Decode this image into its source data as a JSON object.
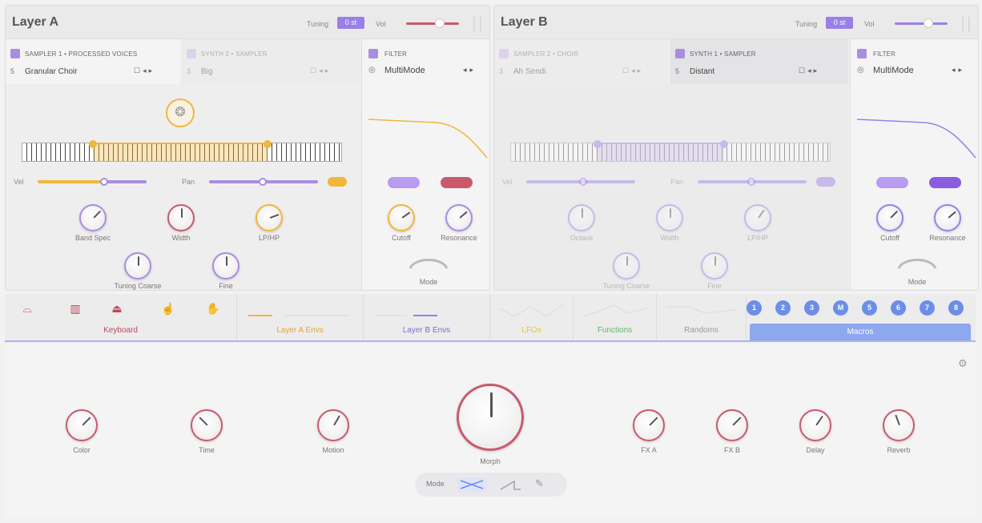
{
  "layer_a": {
    "title": "Layer A",
    "tuning_label": "Tuning",
    "tuning_value": "0 st",
    "vol_label": "Vol",
    "slot1": {
      "title": "SAMPLER 1 • PROCESSED VOICES",
      "number": "5",
      "name": "Granular Choir"
    },
    "slot2": {
      "title": "SYNTH 2 • SAMPLER",
      "number": "3",
      "name": "Big"
    },
    "filter": {
      "title": "FILTER",
      "type": "MultiMode"
    },
    "sliders": {
      "vel_label": "Vel",
      "pan_label": "Pan"
    },
    "knobs": [
      {
        "label": "Band Spec"
      },
      {
        "label": "Width"
      },
      {
        "label": "LP/HP"
      },
      {
        "label": "Tuning Coarse"
      },
      {
        "label": "Fine"
      }
    ],
    "filter_knobs": [
      {
        "label": "Cutoff"
      },
      {
        "label": "Resonance"
      }
    ],
    "mode_label": "Mode"
  },
  "layer_b": {
    "title": "Layer B",
    "tuning_label": "Tuning",
    "tuning_value": "0 st",
    "vol_label": "Vol",
    "slot1": {
      "title": "SAMPLER 2 • CHOIR",
      "number": "3",
      "name": "Ah Sendi"
    },
    "slot2": {
      "title": "SYNTH 1 • SAMPLER",
      "number": "5",
      "name": "Distant"
    },
    "filter": {
      "title": "FILTER",
      "type": "MultiMode"
    },
    "sliders": {
      "vel_label": "Vel",
      "pan_label": "Pan"
    },
    "knobs": [
      {
        "label": "Octave"
      },
      {
        "label": "Width"
      },
      {
        "label": "LP/HP"
      },
      {
        "label": "Tuning Coarse"
      },
      {
        "label": "Fine"
      }
    ],
    "filter_knobs": [
      {
        "label": "Cutoff"
      },
      {
        "label": "Resonance"
      }
    ],
    "mode_label": "Mode"
  },
  "tabs": {
    "keyboard": "Keyboard",
    "layer_a_envs": "Layer A Envs",
    "layer_b_envs": "Layer B Envs",
    "lfos": "LFOs",
    "functions": "Functions",
    "randoms": "Randoms",
    "macros": "Macros",
    "macro_numbers": [
      "1",
      "2",
      "3",
      "M",
      "5",
      "6",
      "7",
      "8"
    ]
  },
  "macros": {
    "knobs": [
      {
        "label": "Color"
      },
      {
        "label": "Time"
      },
      {
        "label": "Motion"
      },
      {
        "label": "FX A"
      },
      {
        "label": "FX B"
      },
      {
        "label": "Delay"
      },
      {
        "label": "Reverb"
      }
    ],
    "morph_label": "Morph",
    "mode_label": "Mode"
  },
  "colors": {
    "layer_a_accent": "#f0b73a",
    "layer_b_accent": "#9b7fe8",
    "macro_accent": "#c85a6c",
    "tab_blue": "#8ea8ef"
  }
}
